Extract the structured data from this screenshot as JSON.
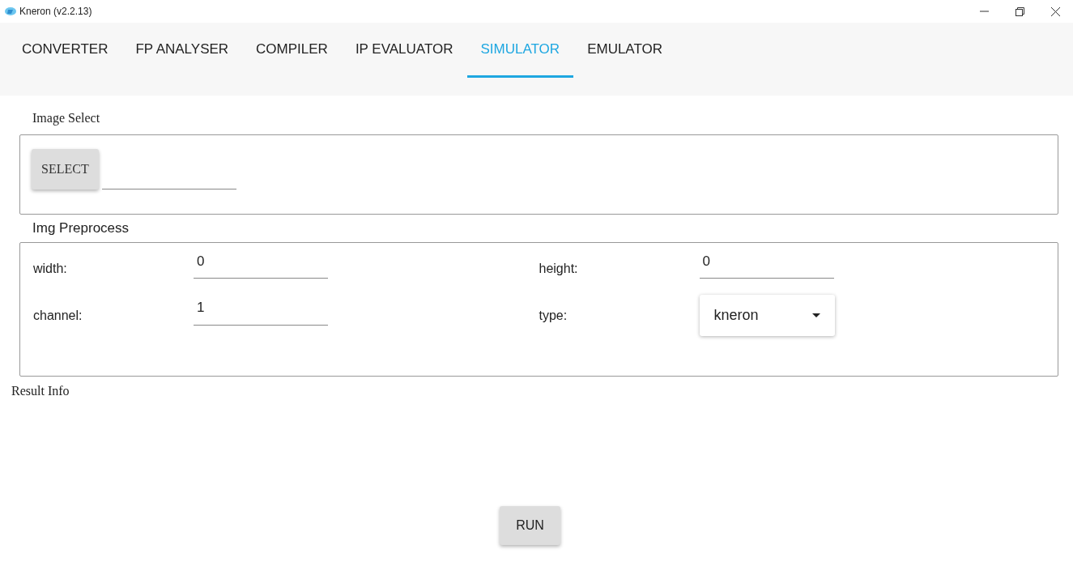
{
  "window": {
    "title": "Kneron (v2.2.13)"
  },
  "tabs": [
    {
      "label": "CONVERTER",
      "selected": false
    },
    {
      "label": "FP ANALYSER",
      "selected": false
    },
    {
      "label": "COMPILER",
      "selected": false
    },
    {
      "label": "IP EVALUATOR",
      "selected": false
    },
    {
      "label": "SIMULATOR",
      "selected": true
    },
    {
      "label": "EMULATOR",
      "selected": false
    }
  ],
  "image_select": {
    "title": "Image Select",
    "button": "SELECT"
  },
  "img_preprocess": {
    "title": "Img Preprocess",
    "fields": [
      {
        "kind": "input",
        "label": "width:",
        "value": "0"
      },
      {
        "kind": "input",
        "label": "height:",
        "value": "0"
      },
      {
        "kind": "input",
        "label": "channel:",
        "value": "1"
      },
      {
        "kind": "dropdown",
        "label": "type:",
        "value": "kneron"
      }
    ]
  },
  "result_info": {
    "title": "Result Info"
  },
  "run_button": "RUN"
}
